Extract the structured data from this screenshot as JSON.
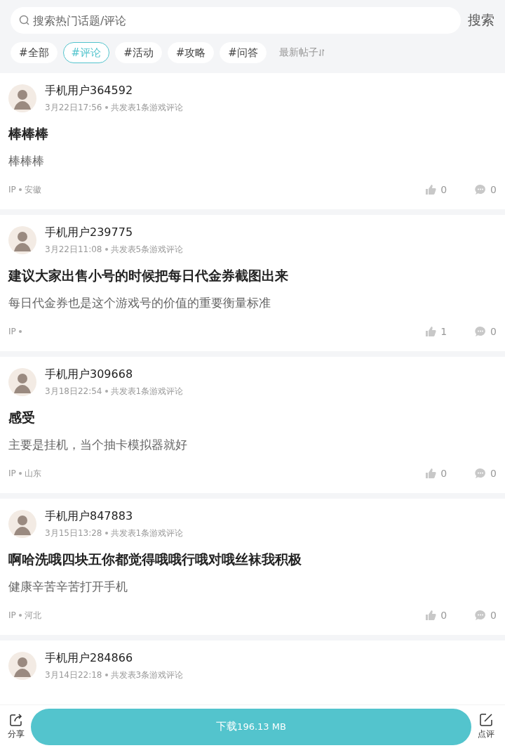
{
  "search": {
    "placeholder": "搜索热门话题/评论",
    "button": "搜索"
  },
  "tags": [
    {
      "label": "#全部",
      "selected": false
    },
    {
      "label": "#评论",
      "selected": true
    },
    {
      "label": "#活动",
      "selected": false
    },
    {
      "label": "#攻略",
      "selected": false
    },
    {
      "label": "#问答",
      "selected": false
    }
  ],
  "sort": {
    "label": "最新帖子"
  },
  "posts": [
    {
      "user": "手机用户364592",
      "time": "3月22日17:56",
      "count": "共发表1条游戏评论",
      "title": "棒棒棒",
      "body": "棒棒棒",
      "ip": "IP",
      "region": "安徽",
      "likes": "0",
      "comments": "0"
    },
    {
      "user": "手机用户239775",
      "time": "3月22日11:08",
      "count": "共发表5条游戏评论",
      "title": "建议大家出售小号的时候把每日代金券截图出来",
      "body": "每日代金券也是这个游戏号的价值的重要衡量标准",
      "ip": "IP",
      "likes": "1",
      "comments": "0"
    },
    {
      "user": "手机用户309668",
      "time": "3月18日22:54",
      "count": "共发表1条游戏评论",
      "title": "感受",
      "body": "主要是挂机，当个抽卡模拟器就好",
      "ip": "IP",
      "region": "山东",
      "likes": "0",
      "comments": "0"
    },
    {
      "user": "手机用户847883",
      "time": "3月15日13:28",
      "count": "共发表1条游戏评论",
      "title": "啊哈洗哦四块五你都觉得哦哦行哦对哦丝袜我积极",
      "body": "健康辛苦辛苦打开手机",
      "ip": "IP",
      "region": "河北",
      "likes": "0",
      "comments": "0"
    },
    {
      "user": "手机用户284866",
      "time": "3月14日22:18",
      "count": "共发表3条游戏评论"
    }
  ],
  "bottom_bar": {
    "share": "分享",
    "download_label": "下载",
    "download_size": "196.13 MB",
    "review": "点评"
  }
}
